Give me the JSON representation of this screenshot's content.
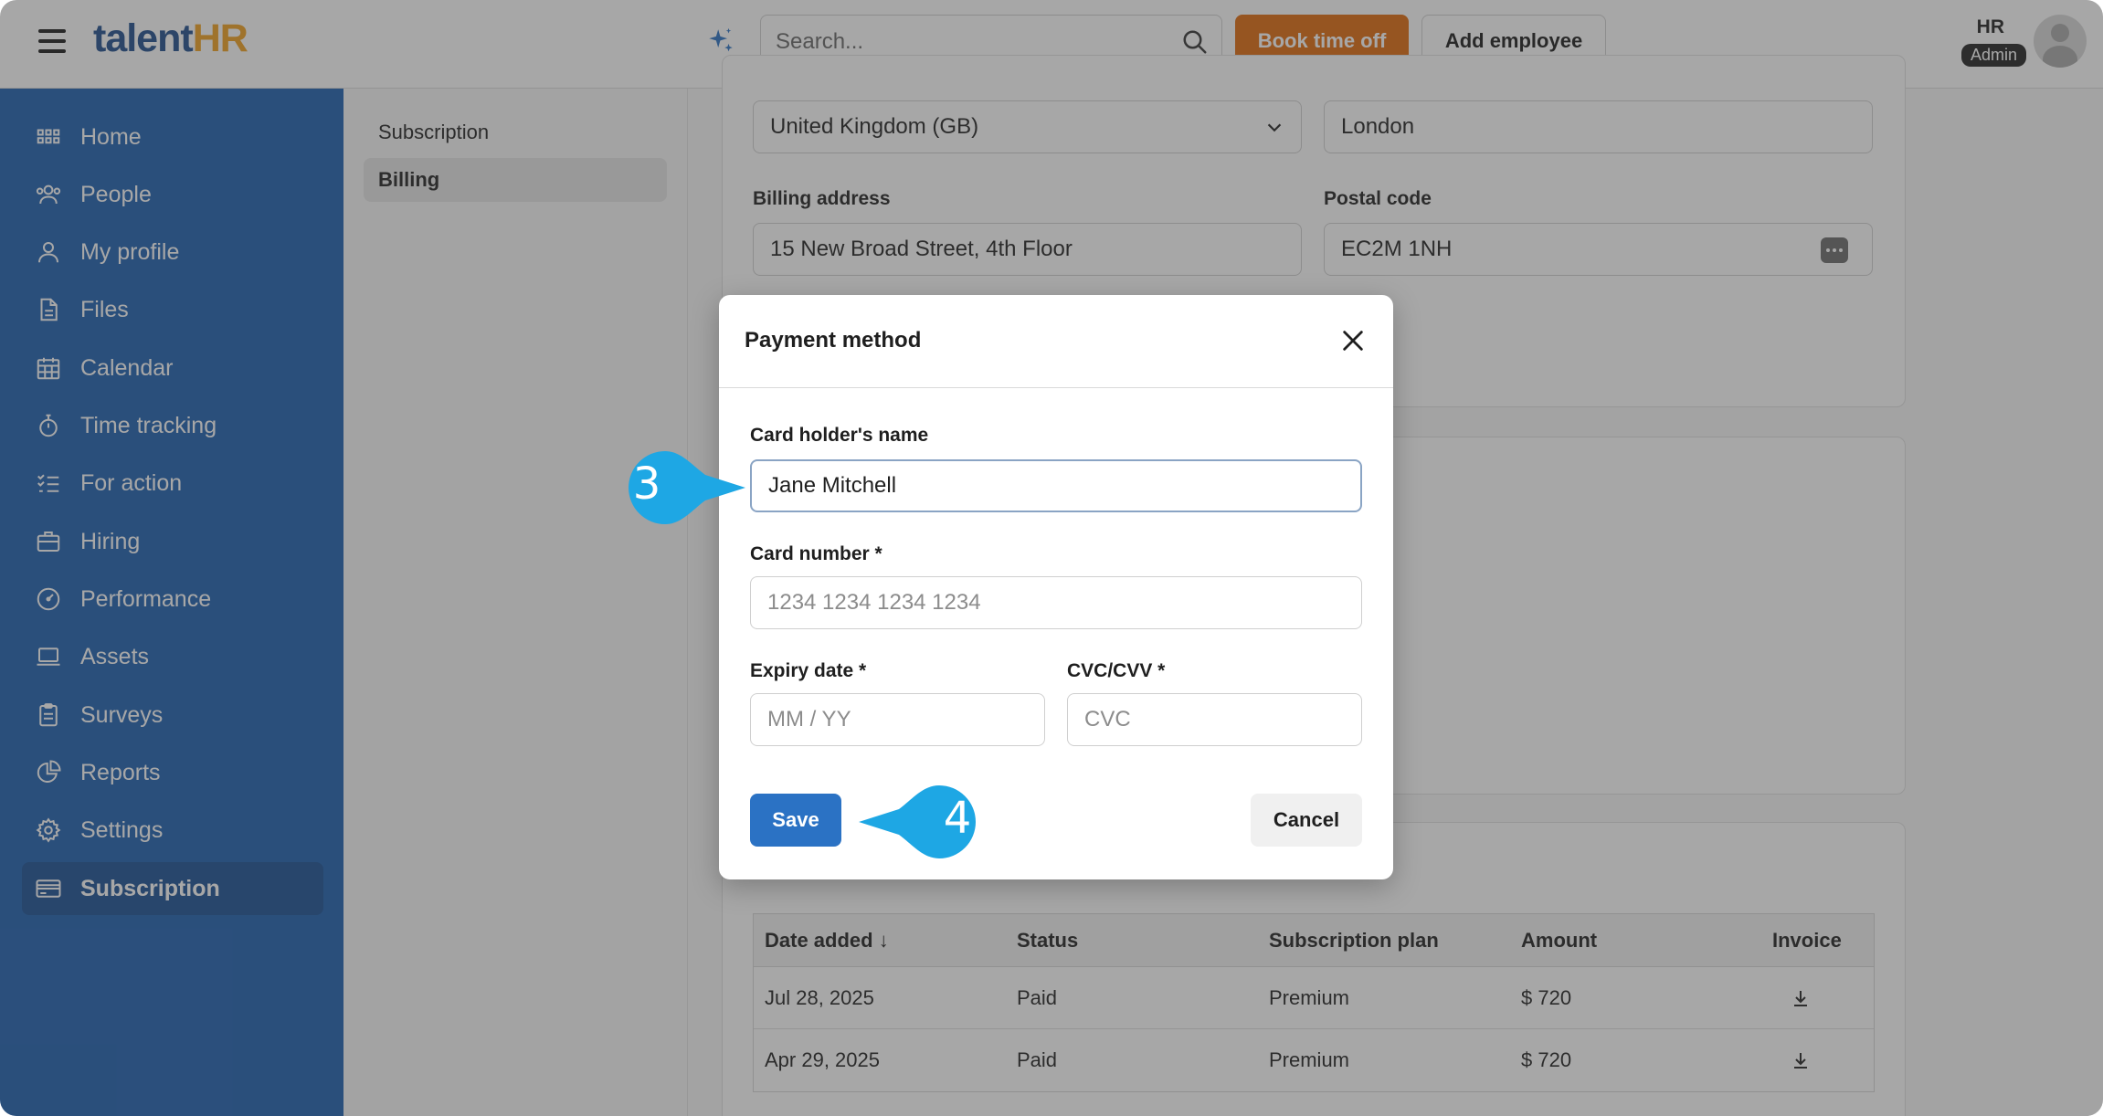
{
  "header": {
    "logo_talent": "talent",
    "logo_hr": "HR",
    "search_placeholder": "Search...",
    "book_time_off_label": "Book time off",
    "add_employee_label": "Add employee",
    "user_role": "HR",
    "user_badge": "Admin"
  },
  "sidebar": {
    "items": [
      {
        "label": "Home",
        "icon": "grid-icon"
      },
      {
        "label": "People",
        "icon": "people-icon"
      },
      {
        "label": "My profile",
        "icon": "person-icon"
      },
      {
        "label": "Files",
        "icon": "file-icon"
      },
      {
        "label": "Calendar",
        "icon": "calendar-icon"
      },
      {
        "label": "Time tracking",
        "icon": "stopwatch-icon"
      },
      {
        "label": "For action",
        "icon": "checklist-icon"
      },
      {
        "label": "Hiring",
        "icon": "briefcase-icon"
      },
      {
        "label": "Performance",
        "icon": "gauge-icon"
      },
      {
        "label": "Assets",
        "icon": "laptop-icon"
      },
      {
        "label": "Surveys",
        "icon": "clipboard-icon"
      },
      {
        "label": "Reports",
        "icon": "pie-chart-icon"
      },
      {
        "label": "Settings",
        "icon": "gear-icon"
      },
      {
        "label": "Subscription",
        "icon": "credit-card-icon",
        "active": true
      }
    ]
  },
  "subnav": {
    "items": [
      {
        "label": "Subscription"
      },
      {
        "label": "Billing",
        "active": true
      }
    ]
  },
  "billing_form": {
    "country_value": "United Kingdom (GB)",
    "city_value": "London",
    "billing_address_label": "Billing address",
    "billing_address_value": "15 New Broad Street, 4th Floor",
    "postal_code_label": "Postal code",
    "postal_code_value": "EC2M 1NH"
  },
  "invoices": {
    "headers": [
      "Date added",
      "Status",
      "Subscription plan",
      "Amount",
      "Invoice"
    ],
    "sort_arrow": "↓",
    "rows": [
      {
        "date": "Jul 28, 2025",
        "status": "Paid",
        "plan": "Premium",
        "amount": "$ 720"
      },
      {
        "date": "Apr 29, 2025",
        "status": "Paid",
        "plan": "Premium",
        "amount": "$ 720"
      }
    ]
  },
  "modal": {
    "title": "Payment method",
    "card_holder_label": "Card holder's name",
    "card_holder_value": "Jane Mitchell",
    "card_number_label": "Card number *",
    "card_number_placeholder": "1234 1234 1234 1234",
    "expiry_label": "Expiry date *",
    "expiry_placeholder": "MM / YY",
    "cvc_label": "CVC/CVV *",
    "cvc_placeholder": "CVC",
    "save_label": "Save",
    "cancel_label": "Cancel"
  },
  "callouts": {
    "step_3": "3",
    "step_4": "4"
  },
  "colors": {
    "sidebar": "#1d5fb0",
    "accent_orange": "#e06a0c",
    "primary_blue": "#2b72c4",
    "callout_blue": "#1ea7e4"
  }
}
